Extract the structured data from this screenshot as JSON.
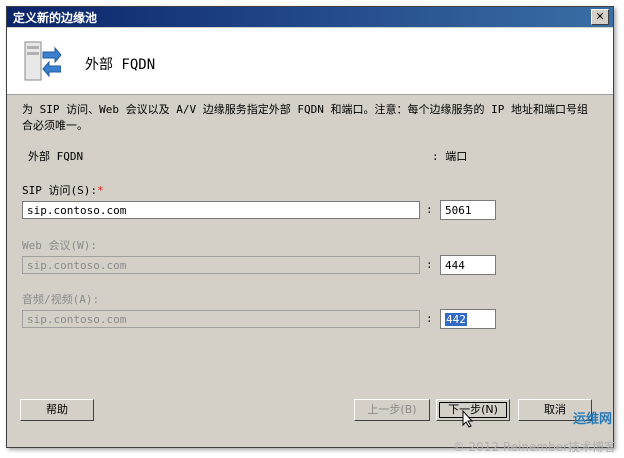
{
  "window": {
    "title": "定义新的边缘池",
    "close_label": "✕"
  },
  "header": {
    "title": "外部 FQDN",
    "icon": "server-arrows-icon"
  },
  "description": "为 SIP 访问、Web 会议以及 A/V 边缘服务指定外部 FQDN 和端口。注意：每个边缘服务的 IP 地址和端口号组合必须唯一。",
  "columns": {
    "fqdn": "外部 FQDN",
    "port": ": 端口"
  },
  "fields": [
    {
      "label": "SIP 访问(S):",
      "required_mark": "*",
      "value": "sip.contoso.com",
      "port": "5061",
      "enabled": true
    },
    {
      "label": "Web 会议(W):",
      "value": "sip.contoso.com",
      "port": "444",
      "enabled": false
    },
    {
      "label": "音频/视频(A):",
      "value": "sip.contoso.com",
      "port": "442",
      "enabled": false
    }
  ],
  "buttons": {
    "help": "帮助",
    "back": "上一步(B)",
    "next": "下一步(N)",
    "cancel": "取消"
  },
  "watermark": "© 2012 Reinember技术博客",
  "watermark_logo": "运维网"
}
